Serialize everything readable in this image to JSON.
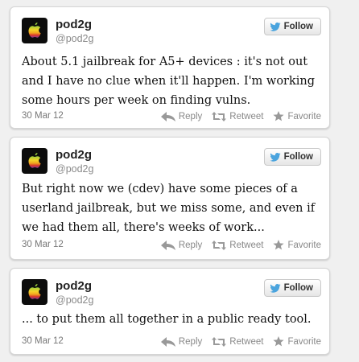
{
  "tweets": [
    {
      "name": "pod2g",
      "handle": "@pod2g",
      "follow_label": "Follow",
      "text": "About 5.1 jailbreak for A5+ devices : it's not out and I have no clue when it'll happen. I'm working some hours per week on finding vulns.",
      "date": "30 Mar 12",
      "actions": {
        "reply": "Reply",
        "retweet": "Retweet",
        "favorite": "Favorite"
      }
    },
    {
      "name": "pod2g",
      "handle": "@pod2g",
      "follow_label": "Follow",
      "text": "But right now we (cdev) have some pieces of a userland jailbreak, but we miss some, and even if we had them all, there's weeks of work...",
      "date": "30 Mar 12",
      "actions": {
        "reply": "Reply",
        "retweet": "Retweet",
        "favorite": "Favorite"
      }
    },
    {
      "name": "pod2g",
      "handle": "@pod2g",
      "follow_label": "Follow",
      "text": "... to put them all together in a public ready tool.",
      "date": "30 Mar 12",
      "actions": {
        "reply": "Reply",
        "retweet": "Retweet",
        "favorite": "Favorite"
      }
    }
  ],
  "colors": {
    "twitter_bird": "#4aa4de",
    "apple_top": "#9bcf3c",
    "apple_mid": "#f2a51f",
    "apple_bottom": "#d9352c"
  }
}
